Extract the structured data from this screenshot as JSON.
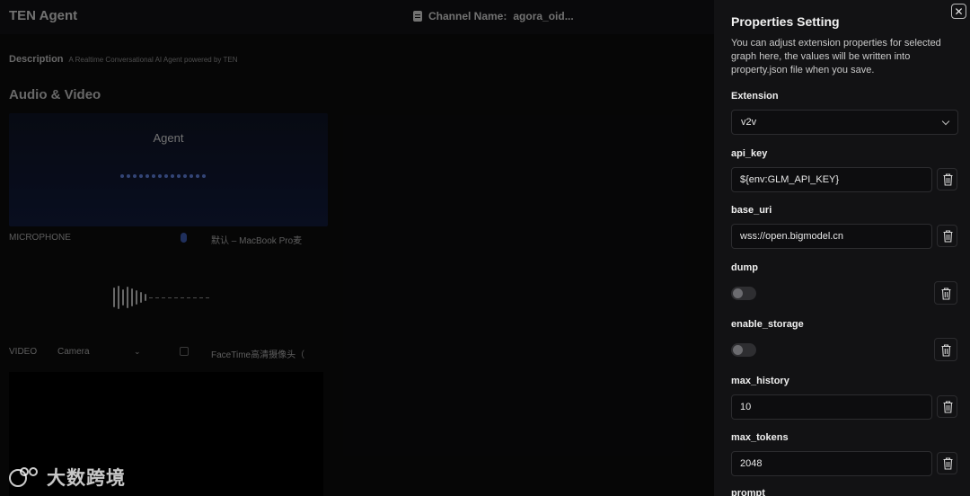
{
  "app": {
    "brand": "TEN Agent",
    "channel_label": "Channel Name:",
    "channel_value": "agora_oid...",
    "description_label": "Description",
    "description_text": "A Realtime Conversational AI Agent powered by TEN",
    "av_title": "Audio & Video",
    "agent_name": "Agent",
    "microphone_label": "MICROPHONE",
    "microphone_device": "默认 – MacBook Pro麦",
    "video_label": "VIDEO",
    "video_source": "Camera",
    "video_device": "FaceTime高清摄像头（",
    "watermark_text": "大数跨境"
  },
  "drawer": {
    "title": "Properties Setting",
    "description": "You can adjust extension properties for selected graph here, the values will be written into property.json file when you save.",
    "close_symbol": "✕",
    "extension_label": "Extension",
    "extension_value": "v2v",
    "fields": {
      "api_key": {
        "label": "api_key",
        "value": "${env:GLM_API_KEY}"
      },
      "base_uri": {
        "label": "base_uri",
        "value": "wss://open.bigmodel.cn"
      },
      "dump": {
        "label": "dump",
        "enabled": false
      },
      "enable_storage": {
        "label": "enable_storage",
        "enabled": false
      },
      "max_history": {
        "label": "max_history",
        "value": "10"
      },
      "max_tokens": {
        "label": "max_tokens",
        "value": "2048"
      },
      "prompt": {
        "label": "prompt"
      }
    }
  }
}
